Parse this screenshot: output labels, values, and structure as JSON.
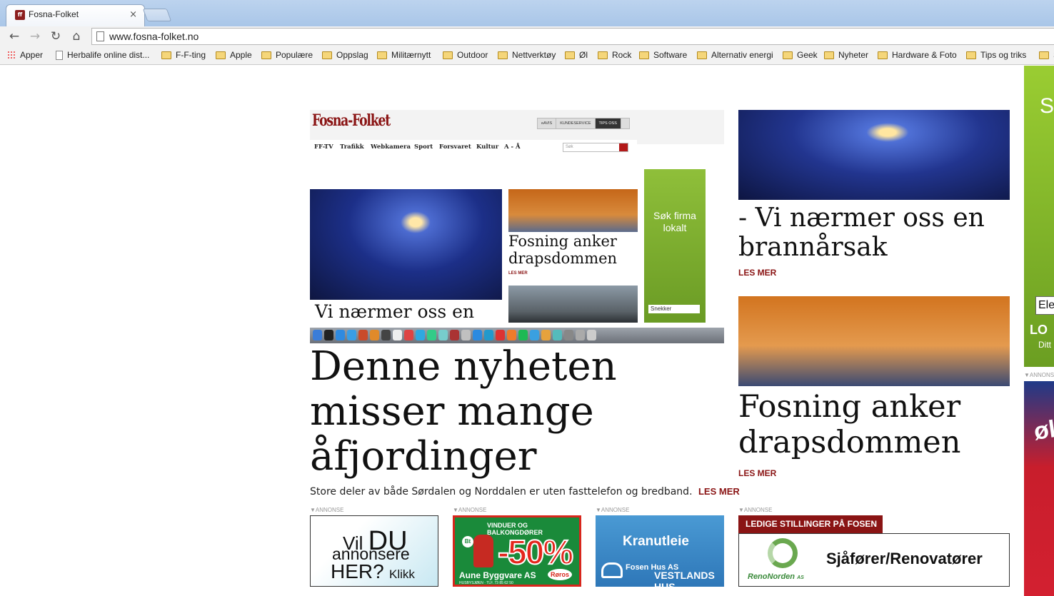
{
  "browser": {
    "tab_title": "Fosna-Folket",
    "tab_close": "×",
    "url": "www.fosna-folket.no",
    "nav": {
      "back": "←",
      "forward": "→",
      "reload": "↻",
      "home": "⌂"
    },
    "bookmarks": [
      {
        "label": "Apper",
        "icon": "apps-grid-icon"
      },
      {
        "label": "Herbalife online dist...",
        "icon": "page-icon"
      },
      {
        "label": "F-F-ting",
        "icon": "folder-icon"
      },
      {
        "label": "Apple",
        "icon": "folder-icon"
      },
      {
        "label": "Populære",
        "icon": "folder-icon"
      },
      {
        "label": "Oppslag",
        "icon": "folder-icon"
      },
      {
        "label": "Militærnytt",
        "icon": "folder-icon"
      },
      {
        "label": "Outdoor",
        "icon": "folder-icon"
      },
      {
        "label": "Nettverktøy",
        "icon": "folder-icon"
      },
      {
        "label": "Øl",
        "icon": "folder-icon"
      },
      {
        "label": "Rock",
        "icon": "folder-icon"
      },
      {
        "label": "Software",
        "icon": "folder-icon"
      },
      {
        "label": "Alternativ energi",
        "icon": "folder-icon"
      },
      {
        "label": "Geek",
        "icon": "folder-icon"
      },
      {
        "label": "Nyheter",
        "icon": "folder-icon"
      },
      {
        "label": "Hardware & Foto",
        "icon": "folder-icon"
      },
      {
        "label": "Tips og triks",
        "icon": "folder-icon"
      },
      {
        "label": "S",
        "icon": "folder-icon"
      }
    ]
  },
  "screenshot": {
    "logo": "Fosna-Folket",
    "top_buttons": [
      "eAVIS",
      "KUNDESERVICE",
      "TIPS OSS"
    ],
    "nav": [
      "FF-TV",
      "Trafikk",
      "Webkamera",
      "Sport",
      "Forsvaret",
      "Kultur",
      "A - Å"
    ],
    "search_placeholder": "Søk",
    "fire_caption": "Vi nærmer oss en",
    "court_caption": "Fosning anker drapsdommen",
    "court_lesmer": "LES MER",
    "ad_text": "Søk firma lokalt",
    "ad_search": "Snekker"
  },
  "main": {
    "headline": "Denne nyheten misser mange åfjordinger",
    "lead": "Store deler av både Sørdalen og Norddalen er uten fasttelefon og bredband.",
    "lesmer": "LES MER"
  },
  "right": {
    "story1_title": "- Vi nærmer oss en brannårsak",
    "story1_lesmer": "LES MER",
    "story2_title": "Fosning anker drapsdommen",
    "story2_lesmer": "LES MER"
  },
  "ads": {
    "annonse_label": "▼ANNONSE",
    "ad1": {
      "l1a": "Vil ",
      "l1b": "DU",
      "l2": "annonsere",
      "l3": "HER?",
      "l4": "Klikk"
    },
    "ad2": {
      "header": "VINDUER OG BALKONGDØRER",
      "percent": "-50%",
      "company": "Aune Byggvare AS",
      "address": "HUSBYSJØEN · TLF. 73 85 62 50",
      "brand": "Røros",
      "bt": "Bt"
    },
    "ad3": {
      "title": "Kranutleie",
      "brand": "Fosen Hus AS",
      "brand2": "VESTLANDS HUS"
    },
    "ad4": {
      "header": "LEDIGE STILLINGER PÅ FOSEN",
      "company": "RenoNorden",
      "company_suffix": "AS",
      "job": "Sjåfører/Renovatører"
    },
    "side1": {
      "letter": "S",
      "input": "Ele",
      "logo": "LO",
      "sub": "Ditt"
    },
    "side2": {
      "big": "øl"
    }
  }
}
